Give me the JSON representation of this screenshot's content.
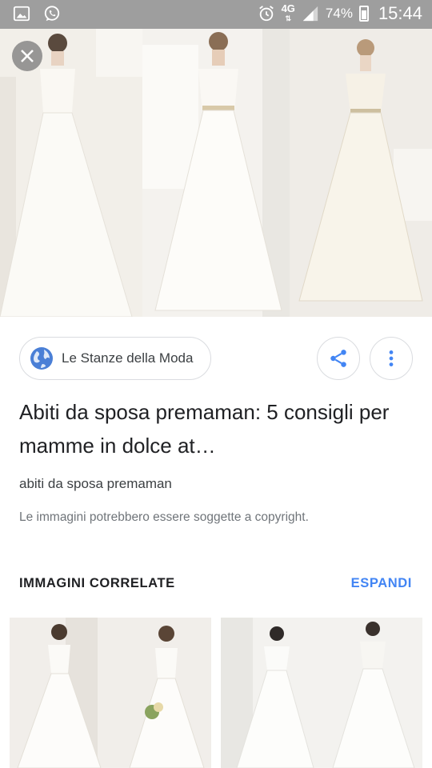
{
  "status_bar": {
    "network": "4G",
    "battery": "74%",
    "time": "15:44",
    "icons": [
      "gallery-icon",
      "whatsapp-icon",
      "alarm-icon",
      "signal-icon",
      "battery-icon"
    ]
  },
  "viewer": {
    "close_icon": "close-icon",
    "source": {
      "name": "Le Stanze della Moda",
      "icon": "globe-icon"
    },
    "share_icon": "share-icon",
    "more_icon": "more-vert-icon",
    "title": "Abiti da sposa premaman: 5 consigli per mamme in dolce at…",
    "subtitle": "abiti da sposa premaman",
    "copyright_note": "Le immagini potrebbero essere soggette a copyright."
  },
  "related": {
    "header": "IMMAGINI CORRELATE",
    "expand_label": "ESPANDI"
  },
  "colors": {
    "status_bar": "#9e9e9e",
    "accent": "#4285f4",
    "text_primary": "#202124",
    "text_secondary": "#70757a"
  }
}
